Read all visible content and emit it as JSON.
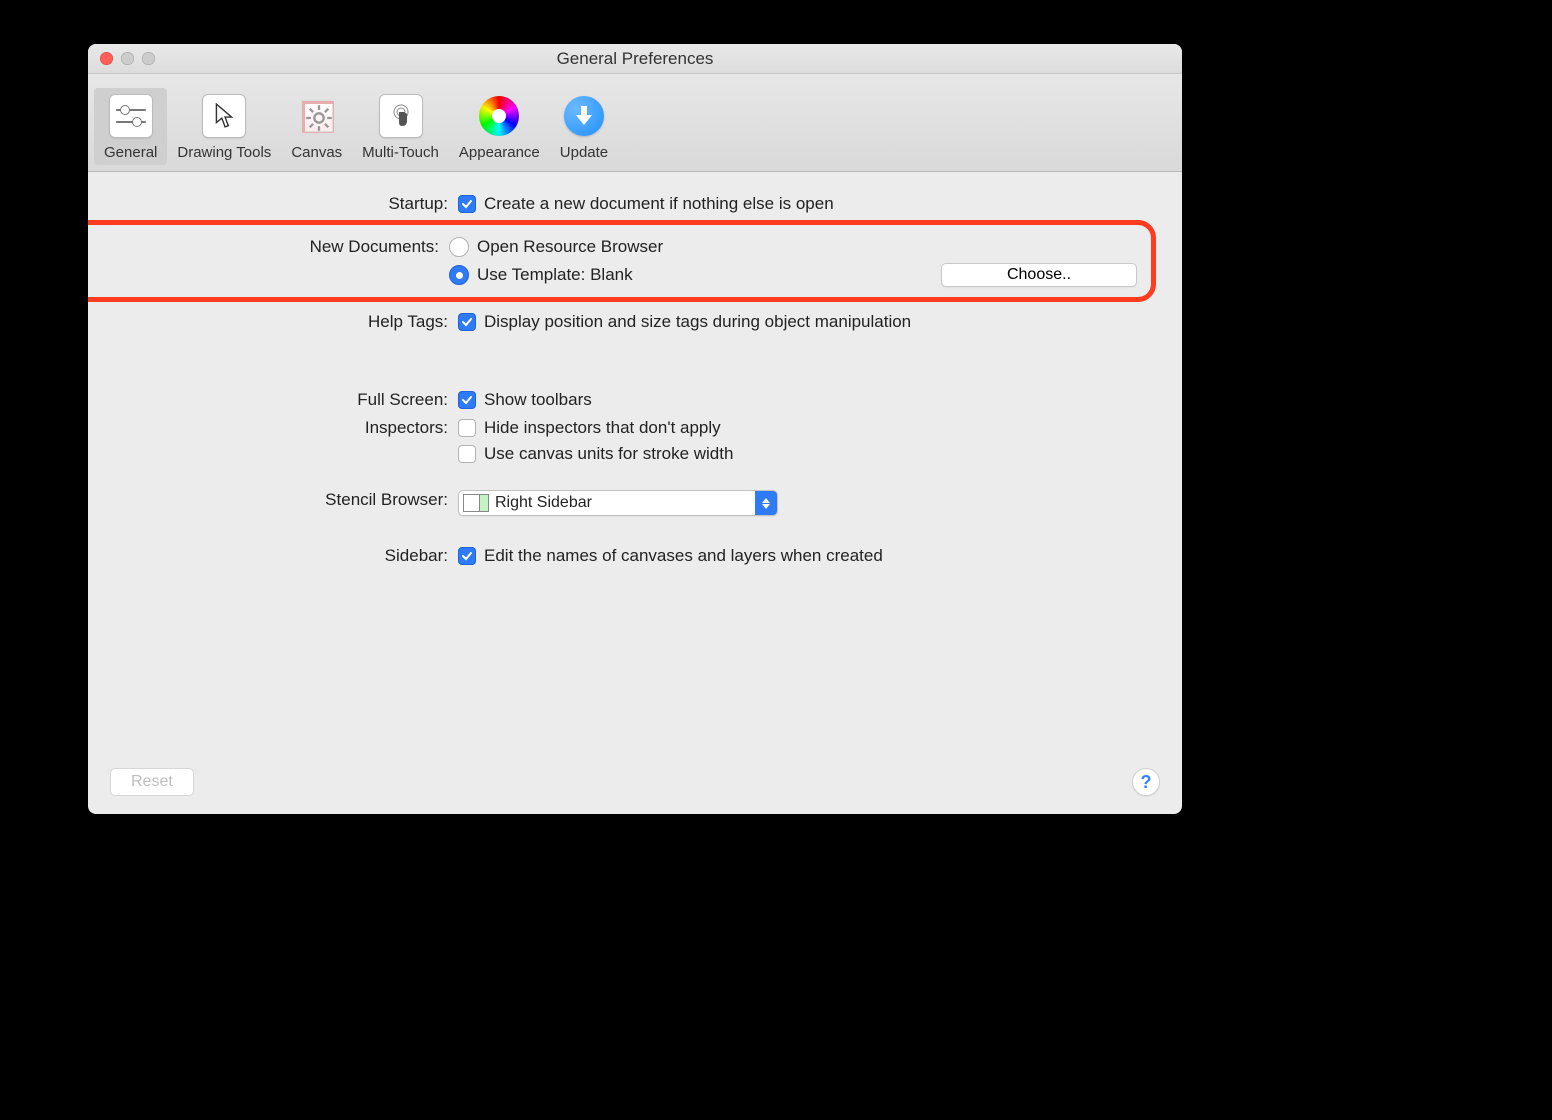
{
  "window": {
    "title": "General Preferences"
  },
  "toolbar": {
    "items": [
      {
        "label": "General"
      },
      {
        "label": "Drawing Tools"
      },
      {
        "label": "Canvas"
      },
      {
        "label": "Multi-Touch"
      },
      {
        "label": "Appearance"
      },
      {
        "label": "Update"
      }
    ]
  },
  "sections": {
    "startup": {
      "label": "Startup:",
      "create_doc": "Create a new document if nothing else is open"
    },
    "new_documents": {
      "label": "New Documents:",
      "open_browser": "Open Resource Browser",
      "use_template": "Use Template: Blank",
      "choose": "Choose.."
    },
    "help_tags": {
      "label": "Help Tags:",
      "text": "Display position and size tags during object manipulation"
    },
    "full_screen": {
      "label": "Full Screen:",
      "text": "Show toolbars"
    },
    "inspectors": {
      "label": "Inspectors:",
      "hide": "Hide inspectors that don't apply",
      "units": "Use canvas units for stroke width"
    },
    "stencil": {
      "label": "Stencil Browser:",
      "value": "Right Sidebar"
    },
    "sidebar": {
      "label": "Sidebar:",
      "text": "Edit the names of canvases and layers when created"
    }
  },
  "footer": {
    "reset": "Reset",
    "help": "?"
  }
}
